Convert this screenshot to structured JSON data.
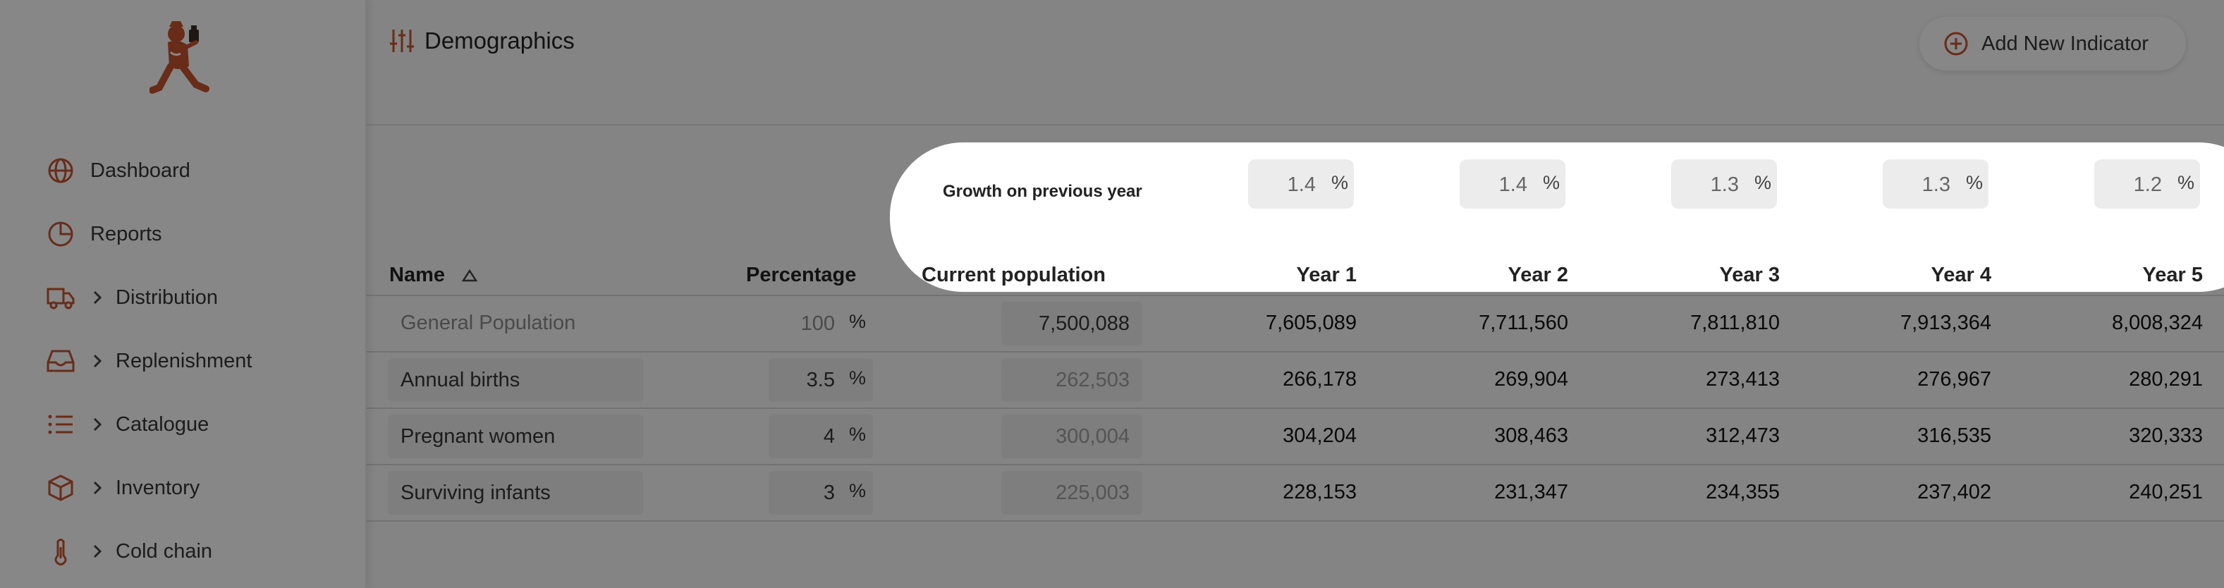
{
  "sidebar": {
    "items": [
      {
        "label": "Dashboard",
        "icon": "globe-icon",
        "has_chevron": false
      },
      {
        "label": "Reports",
        "icon": "pie-chart-icon",
        "has_chevron": false
      },
      {
        "label": "Distribution",
        "icon": "truck-icon",
        "has_chevron": true
      },
      {
        "label": "Replenishment",
        "icon": "inbox-tray-icon",
        "has_chevron": true
      },
      {
        "label": "Catalogue",
        "icon": "list-icon",
        "has_chevron": true
      },
      {
        "label": "Inventory",
        "icon": "box-icon",
        "has_chevron": true
      },
      {
        "label": "Cold chain",
        "icon": "thermometer-icon",
        "has_chevron": true
      }
    ]
  },
  "header": {
    "title": "Demographics",
    "title_icon": "sliders-icon",
    "add_button_label": "Add New Indicator",
    "add_button_icon": "plus-circle-icon"
  },
  "growth": {
    "label": "Growth on previous year",
    "values": [
      "1.4",
      "1.4",
      "1.3",
      "1.3",
      "1.2"
    ],
    "unit": "%"
  },
  "table": {
    "columns": {
      "name": "Name",
      "percentage": "Percentage",
      "current_population": "Current population",
      "year1": "Year 1",
      "year2": "Year 2",
      "year3": "Year 3",
      "year4": "Year 4",
      "year5": "Year 5"
    },
    "rows": [
      {
        "name": "General Population",
        "percentage": "100",
        "current": "7,500,088",
        "years": [
          "7,605,089",
          "7,711,560",
          "7,811,810",
          "7,913,364",
          "8,008,324"
        ]
      },
      {
        "name": "Annual births",
        "percentage": "3.5",
        "current": "262,503",
        "years": [
          "266,178",
          "269,904",
          "273,413",
          "276,967",
          "280,291"
        ]
      },
      {
        "name": "Pregnant women",
        "percentage": "4",
        "current": "300,004",
        "years": [
          "304,204",
          "308,463",
          "312,473",
          "316,535",
          "320,333"
        ]
      },
      {
        "name": "Surviving infants",
        "percentage": "3",
        "current": "225,003",
        "years": [
          "228,153",
          "231,347",
          "234,355",
          "237,402",
          "240,251"
        ]
      }
    ],
    "percent_sign": "%"
  },
  "colors": {
    "accent": "#c0512f",
    "overlay": "rgba(0,0,0,0.45)",
    "spotlight": "#ffffff"
  }
}
